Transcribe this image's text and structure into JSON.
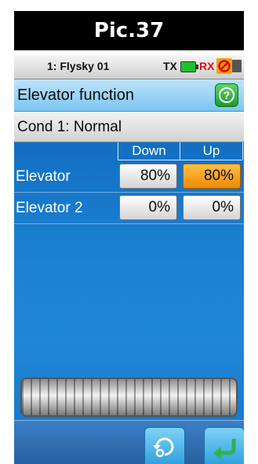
{
  "banner": {
    "title": "Pic.37"
  },
  "status": {
    "model": "1: Flysky 01",
    "tx_label": "TX",
    "rx_label": "RX",
    "tx_battery_color": "#22c22a",
    "rx_color": "#e01010"
  },
  "header": {
    "title": "Elevator function",
    "help_icon": "help-icon",
    "help_symbol": "?"
  },
  "condition": {
    "label": "Cond 1: Normal"
  },
  "table": {
    "columns": [
      "Down",
      "Up"
    ],
    "rows": [
      {
        "label": "Elevator",
        "down": "80%",
        "up": "80%",
        "active": "up"
      },
      {
        "label": "Elevator 2",
        "down": "0%",
        "up": "0%"
      }
    ]
  },
  "colors": {
    "accent": "#f08a00",
    "background": "#1b7fd0",
    "help_green": "#1f9a2c"
  },
  "footer": {
    "reset_icon": "reset-icon",
    "back_icon": "back-icon"
  }
}
